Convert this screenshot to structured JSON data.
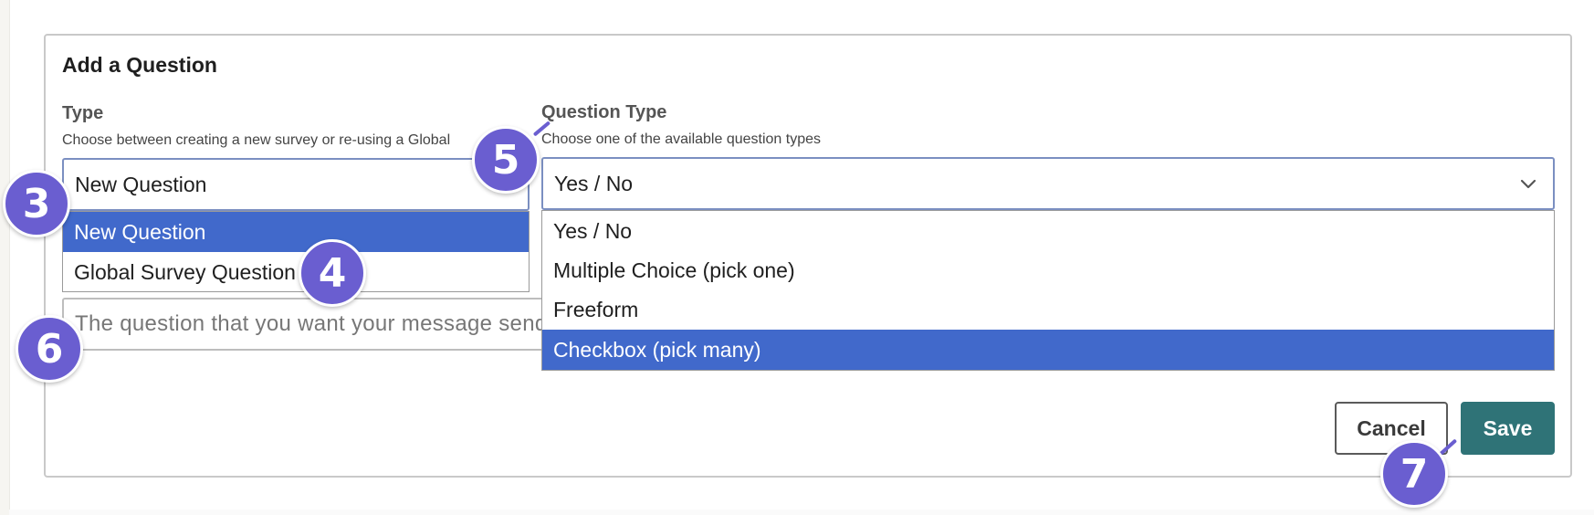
{
  "form": {
    "title": "Add a Question",
    "type_field": {
      "label": "Type",
      "help": "Choose between creating a new survey or re-using a Global",
      "value": "New Question",
      "options": [
        {
          "label": "New Question",
          "selected": true
        },
        {
          "label": "Global Survey Question",
          "selected": false
        }
      ]
    },
    "question_type_field": {
      "label": "Question Type",
      "help": "Choose one of the available question types",
      "value": "Yes / No",
      "options": [
        {
          "label": "Yes / No",
          "selected": false
        },
        {
          "label": "Multiple Choice (pick one)",
          "selected": false
        },
        {
          "label": "Freeform",
          "selected": false
        },
        {
          "label": "Checkbox (pick many)",
          "selected": true
        }
      ]
    },
    "question_input": {
      "placeholder": "The question that you want your message send"
    },
    "buttons": {
      "cancel": "Cancel",
      "save": "Save"
    }
  },
  "annotations": {
    "badge_3": "3",
    "badge_4": "4",
    "badge_5": "5",
    "badge_6": "6",
    "badge_7": "7"
  },
  "colors": {
    "highlight": "#4169cb",
    "save_button": "#2f7377",
    "badge": "#6a5ed0",
    "focus_border": "#7b8fc1"
  },
  "icons": {
    "dropdown": "chevron-down-icon"
  }
}
